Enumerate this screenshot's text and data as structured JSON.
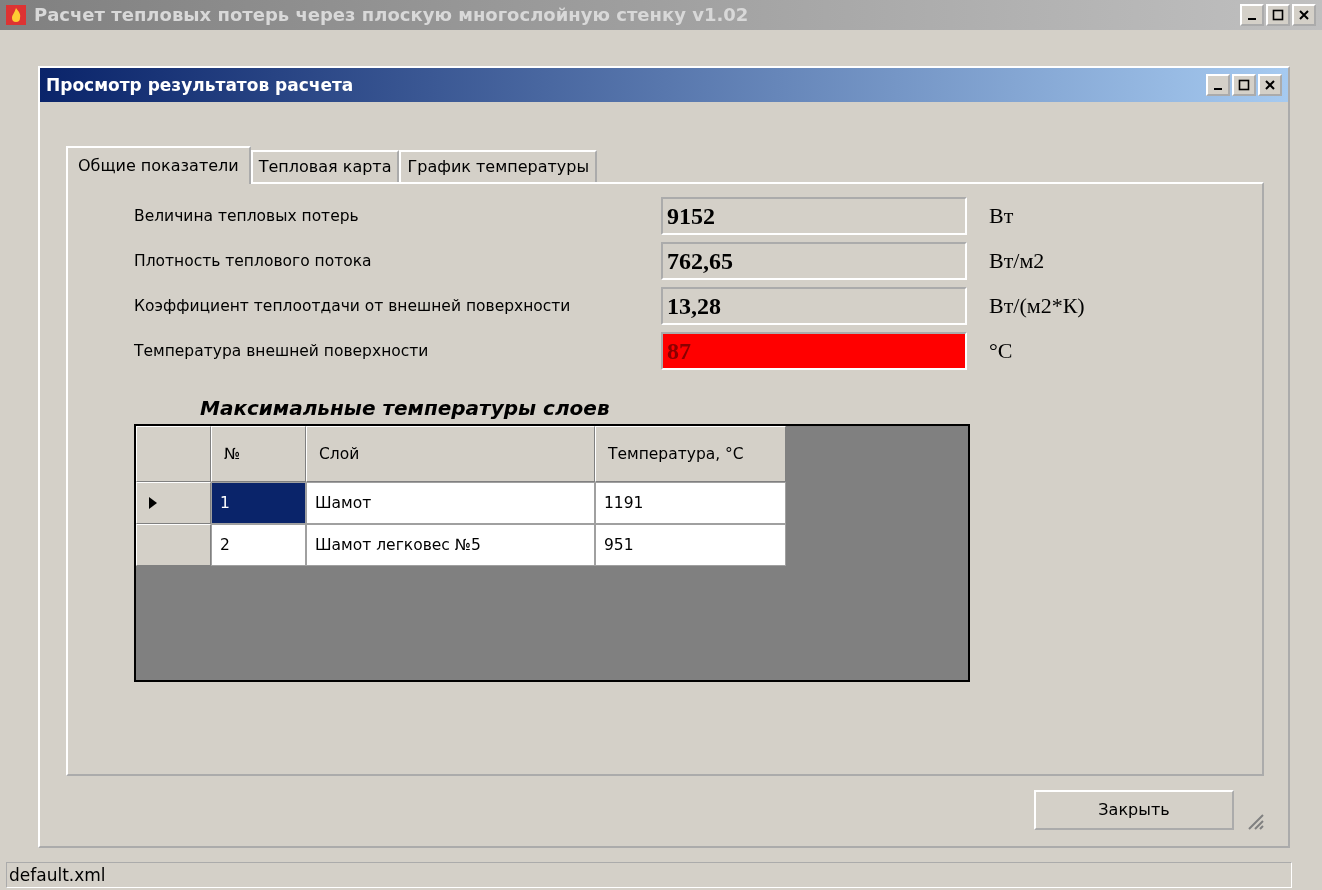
{
  "main_window": {
    "title": "Расчет тепловых потерь через плоскую многослойную стенку v1.02"
  },
  "dialog": {
    "title": "Просмотр результатов расчета",
    "tabs": [
      {
        "label": "Общие показатели",
        "selected": true
      },
      {
        "label": "Тепловая карта",
        "selected": false
      },
      {
        "label": "График температуры",
        "selected": false
      }
    ],
    "results": [
      {
        "label": "Величина тепловых потерь",
        "value": "9152",
        "unit": "Вт",
        "alarm": false
      },
      {
        "label": "Плотность теплового потока",
        "value": "762,65",
        "unit": "Вт/м2",
        "alarm": false
      },
      {
        "label": "Коэффициент теплоотдачи от внешней поверхности",
        "value": "13,28",
        "unit": "Вт/(м2*К)",
        "alarm": false
      },
      {
        "label": "Температура внешней поверхности",
        "value": "87",
        "unit": "°C",
        "alarm": true
      }
    ],
    "table": {
      "title": "Максимальные температуры слоев",
      "columns": [
        "№",
        "Слой",
        "Температура, °C"
      ],
      "rows": [
        {
          "cells": [
            "1",
            "Шамот",
            "1191"
          ],
          "selected": true
        },
        {
          "cells": [
            "2",
            "Шамот легковес №5",
            "951"
          ],
          "selected": false
        }
      ]
    },
    "close_button": "Закрыть"
  },
  "status_bar": {
    "text": "default.xml"
  }
}
